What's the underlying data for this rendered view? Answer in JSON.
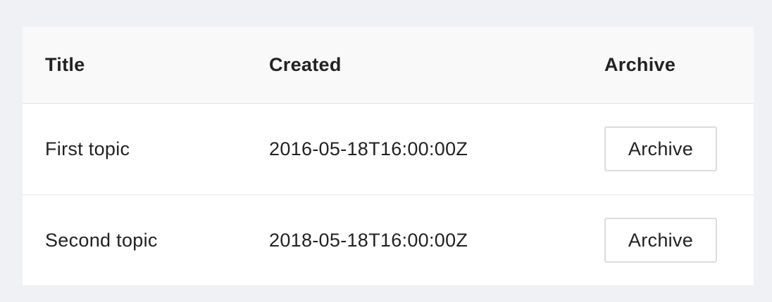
{
  "table": {
    "headers": {
      "title": "Title",
      "created": "Created",
      "archive": "Archive"
    },
    "rows": [
      {
        "title": "First topic",
        "created": "2016-05-18T16:00:00Z",
        "action_label": "Archive"
      },
      {
        "title": "Second topic",
        "created": "2018-05-18T16:00:00Z",
        "action_label": "Archive"
      }
    ]
  }
}
